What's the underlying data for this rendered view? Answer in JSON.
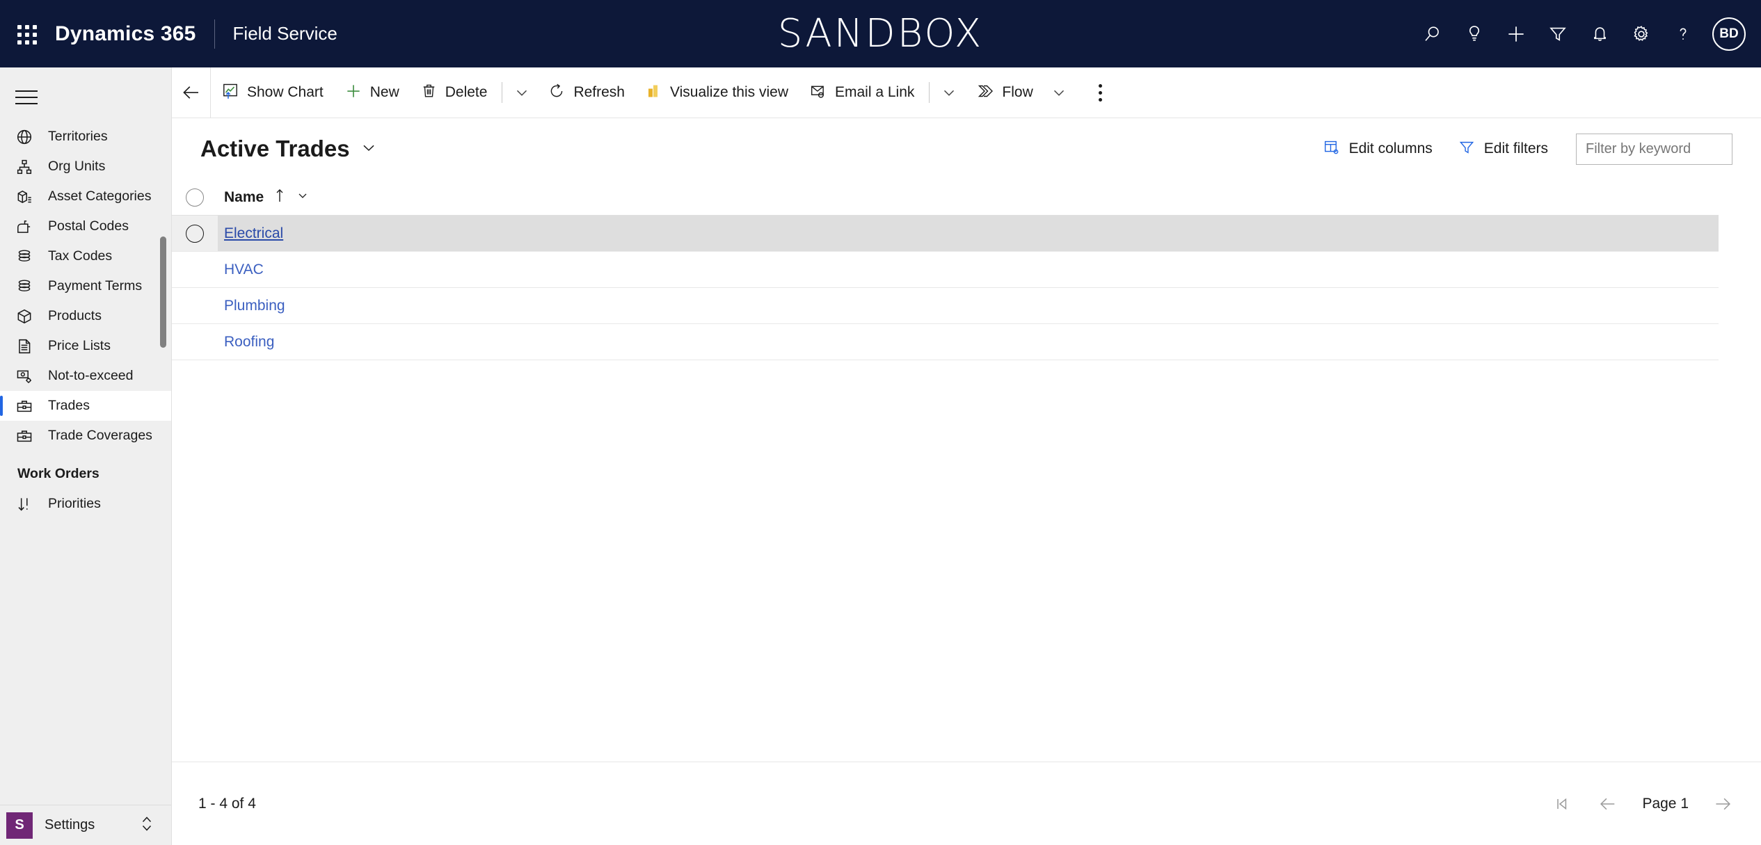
{
  "header": {
    "waffle_icon": "app-launcher-icon",
    "brand": "Dynamics 365",
    "app_module": "Field Service",
    "environment_banner": "SANDBOX",
    "actions": [
      {
        "name": "search-icon",
        "label": "Search"
      },
      {
        "name": "lightbulb-icon",
        "label": "Ideas"
      },
      {
        "name": "plus-icon",
        "label": "Quick create"
      },
      {
        "name": "filter-icon",
        "label": "Filter"
      },
      {
        "name": "bell-icon",
        "label": "Notifications"
      },
      {
        "name": "gear-icon",
        "label": "Settings"
      },
      {
        "name": "question-icon",
        "label": "Help"
      }
    ],
    "avatar_initials": "BD"
  },
  "sidebar": {
    "toggle_label": "Expand/Collapse navigation",
    "items": [
      {
        "label": "Territories",
        "icon": "globe-icon",
        "selected": false
      },
      {
        "label": "Org Units",
        "icon": "org-chart-icon",
        "selected": false
      },
      {
        "label": "Asset Categories",
        "icon": "asset-box-icon",
        "selected": false
      },
      {
        "label": "Postal Codes",
        "icon": "mailbox-icon",
        "selected": false
      },
      {
        "label": "Tax Codes",
        "icon": "coins-icon",
        "selected": false
      },
      {
        "label": "Payment Terms",
        "icon": "coins-icon",
        "selected": false
      },
      {
        "label": "Products",
        "icon": "package-icon",
        "selected": false
      },
      {
        "label": "Price Lists",
        "icon": "document-list-icon",
        "selected": false
      },
      {
        "label": "Not-to-exceed",
        "icon": "money-gear-icon",
        "selected": false
      },
      {
        "label": "Trades",
        "icon": "toolbox-icon",
        "selected": true
      },
      {
        "label": "Trade Coverages",
        "icon": "toolbox-icon",
        "selected": false
      }
    ],
    "group_title": "Work Orders",
    "group_items": [
      {
        "label": "Priorities",
        "icon": "sort-descending-icon",
        "selected": false
      }
    ],
    "settings": {
      "badge": "S",
      "label": "Settings",
      "chevron_icon": "chevron-up-down-icon"
    }
  },
  "command_bar": {
    "back_icon": "arrow-left-icon",
    "buttons": [
      {
        "label": "Show Chart",
        "icon": "chart-icon"
      },
      {
        "label": "New",
        "icon": "plus-icon"
      },
      {
        "label": "Delete",
        "icon": "trash-icon"
      }
    ],
    "overflow_caret_1": "chevron-down-icon",
    "buttons2": [
      {
        "label": "Refresh",
        "icon": "refresh-icon"
      },
      {
        "label": "Visualize this view",
        "icon": "powerbi-bars-icon"
      },
      {
        "label": "Email a Link",
        "icon": "email-link-icon"
      }
    ],
    "overflow_caret_2": "chevron-down-icon",
    "flow": {
      "label": "Flow",
      "icon": "flow-icon",
      "caret": "chevron-down-icon"
    },
    "overflow_icon": "more-vertical-icon"
  },
  "view": {
    "title": "Active Trades",
    "title_caret": "chevron-down-icon",
    "edit_columns": {
      "label": "Edit columns",
      "icon": "edit-columns-icon"
    },
    "edit_filters": {
      "label": "Edit filters",
      "icon": "edit-filters-icon"
    },
    "search": {
      "value": "",
      "placeholder": "Filter by keyword"
    }
  },
  "grid": {
    "select_all_icon": "select-all-circle",
    "columns": [
      {
        "label": "Name",
        "sort": "ascending",
        "sort_icon": "arrow-up-icon",
        "menu_icon": "chevron-down-icon"
      }
    ],
    "rows": [
      {
        "name": "Electrical",
        "selected": true
      },
      {
        "name": "HVAC",
        "selected": false
      },
      {
        "name": "Plumbing",
        "selected": false
      },
      {
        "name": "Roofing",
        "selected": false
      }
    ]
  },
  "footer": {
    "record_count": "1 - 4 of 4",
    "first_page_icon": "page-first-icon",
    "previous_page_icon": "arrow-left-icon",
    "page_label": "Page 1",
    "next_page_icon": "arrow-right-icon"
  },
  "colors": {
    "header_bg": "#0D1839",
    "sidebar_bg": "#EFEFEF",
    "selection_accent": "#2266E3",
    "link": "#3B5FC0",
    "settings_badge": "#702776",
    "selected_row": "#DEDEDE"
  }
}
